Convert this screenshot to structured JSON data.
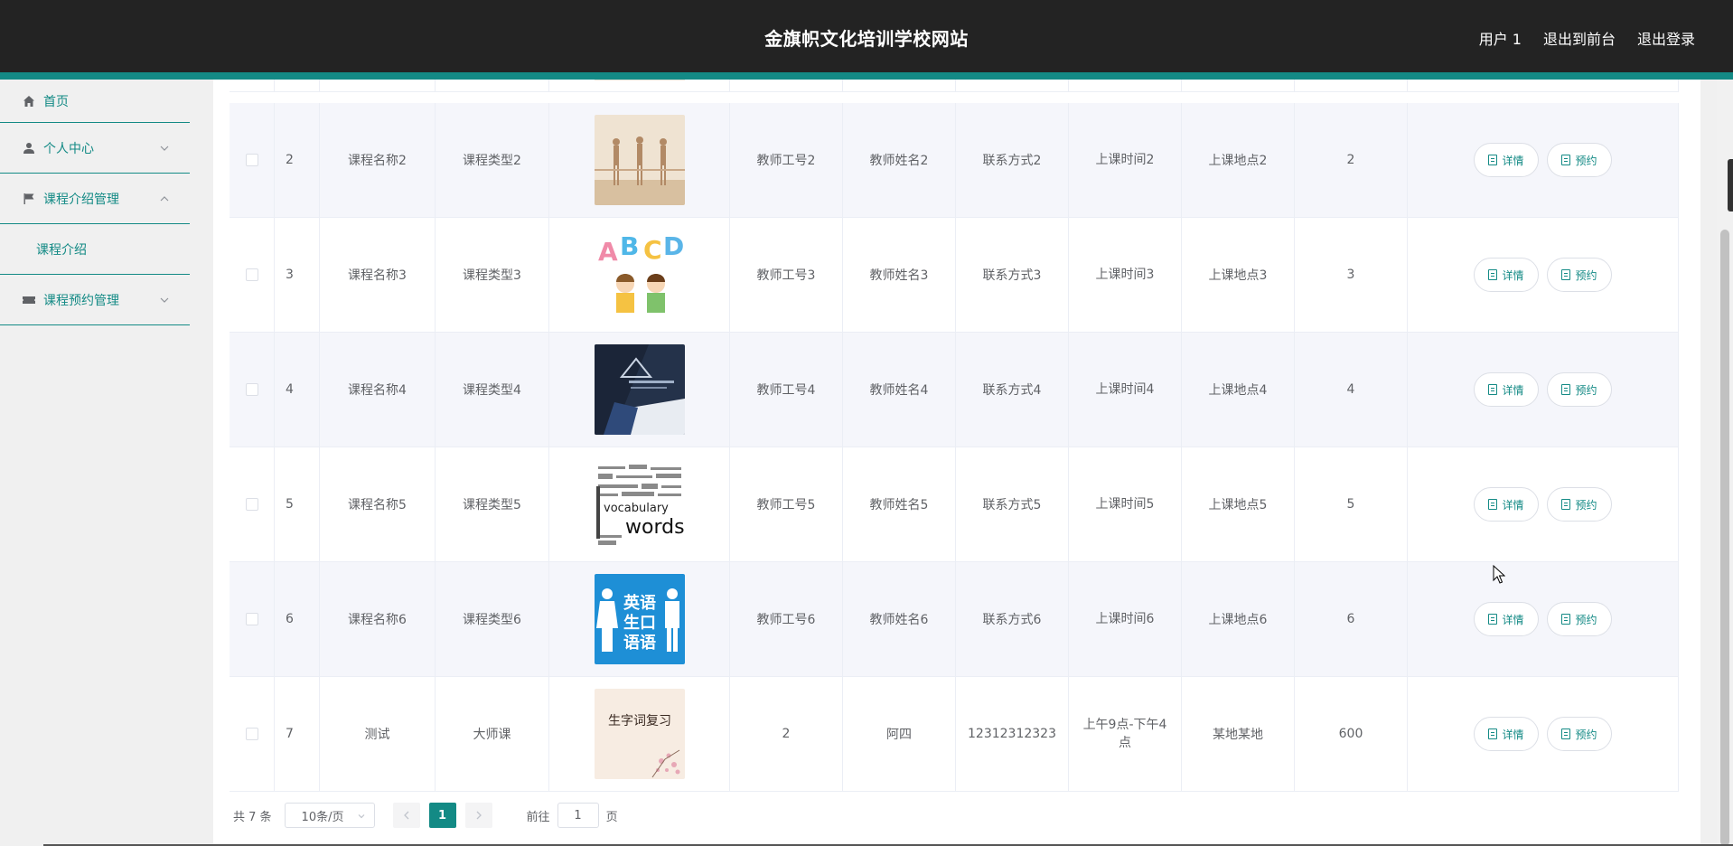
{
  "header": {
    "site_title": "金旗帜文化培训学校网站",
    "user_label": "用户 1",
    "back_to_front": "退出到前台",
    "logout": "退出登录"
  },
  "sidebar": {
    "home": "首页",
    "personal_center": "个人中心",
    "course_intro_mgmt": "课程介绍管理",
    "course_intro": "课程介绍",
    "course_booking_mgmt": "课程预约管理"
  },
  "table": {
    "detail_label": "详情",
    "book_label": "预约",
    "rows": [
      {
        "idx": "2",
        "name": "课程名称2",
        "type": "课程类型2",
        "image": "dancers-photo",
        "teacher_no": "教师工号2",
        "teacher_name": "教师姓名2",
        "phone": "联系方式2",
        "time": "上课时间2",
        "place": "上课地点2",
        "num": "2"
      },
      {
        "idx": "3",
        "name": "课程名称3",
        "type": "课程类型3",
        "image": "abcd-kids-illustration",
        "teacher_no": "教师工号3",
        "teacher_name": "教师姓名3",
        "phone": "联系方式3",
        "time": "上课时间3",
        "place": "上课地点3",
        "num": "3"
      },
      {
        "idx": "4",
        "name": "课程名称4",
        "type": "课程类型4",
        "image": "study-photo",
        "teacher_no": "教师工号4",
        "teacher_name": "教师姓名4",
        "phone": "联系方式4",
        "time": "上课时间4",
        "place": "上课地点4",
        "num": "4"
      },
      {
        "idx": "5",
        "name": "课程名称5",
        "type": "课程类型5",
        "image": "vocabulary-words-cloud",
        "teacher_no": "教师工号5",
        "teacher_name": "教师姓名5",
        "phone": "联系方式5",
        "time": "上课时间5",
        "place": "上课地点5",
        "num": "5"
      },
      {
        "idx": "6",
        "name": "课程名称6",
        "type": "课程类型6",
        "image": "english-speaking-poster",
        "teacher_no": "教师工号6",
        "teacher_name": "教师姓名6",
        "phone": "联系方式6",
        "time": "上课时间6",
        "place": "上课地点6",
        "num": "6"
      },
      {
        "idx": "7",
        "name": "测试",
        "type": "大师课",
        "image": "vocabulary-review-card",
        "teacher_no": "2",
        "teacher_name": "阿四",
        "phone": "12312312323",
        "time": "上午9点-下午4点",
        "place": "某地某地",
        "num": "600"
      }
    ]
  },
  "thumb_text": {
    "english_1": "英语",
    "english_2": "生口",
    "english_3": "语语",
    "review": "生字词复习",
    "words": "words",
    "vocab": "vocabulary"
  },
  "pagination": {
    "total": "共 7 条",
    "page_size": "10条/页",
    "current_page": "1",
    "goto_prefix": "前往",
    "goto_value": "1",
    "goto_suffix": "页"
  },
  "colors": {
    "accent": "#138a85",
    "header_bg": "#232323"
  }
}
